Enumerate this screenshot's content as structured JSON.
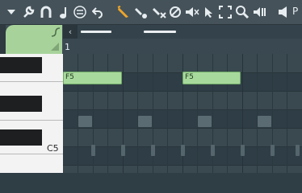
{
  "toolbar": {
    "icons": [
      "menu-arrow-icon",
      "wrench-icon",
      "magnet-icon",
      "note-icon",
      "list-icon",
      "undo-icon",
      "pencil-icon",
      "paint-icon",
      "delete-icon",
      "mute-icon",
      "volume-icon",
      "select-icon",
      "zoom-fit-icon",
      "zoom-icon",
      "playback-icon",
      "speaker-icon"
    ],
    "trailing_label": "P"
  },
  "ruler": {
    "bar_number": "1"
  },
  "piano": {
    "label_c5": "C5"
  },
  "notes": [
    {
      "label": "F5"
    },
    {
      "label": "F5"
    }
  ],
  "colors": {
    "note_fill": "#a8d99c",
    "tab_green": "#a7d39b",
    "background": "#2f3d45"
  }
}
